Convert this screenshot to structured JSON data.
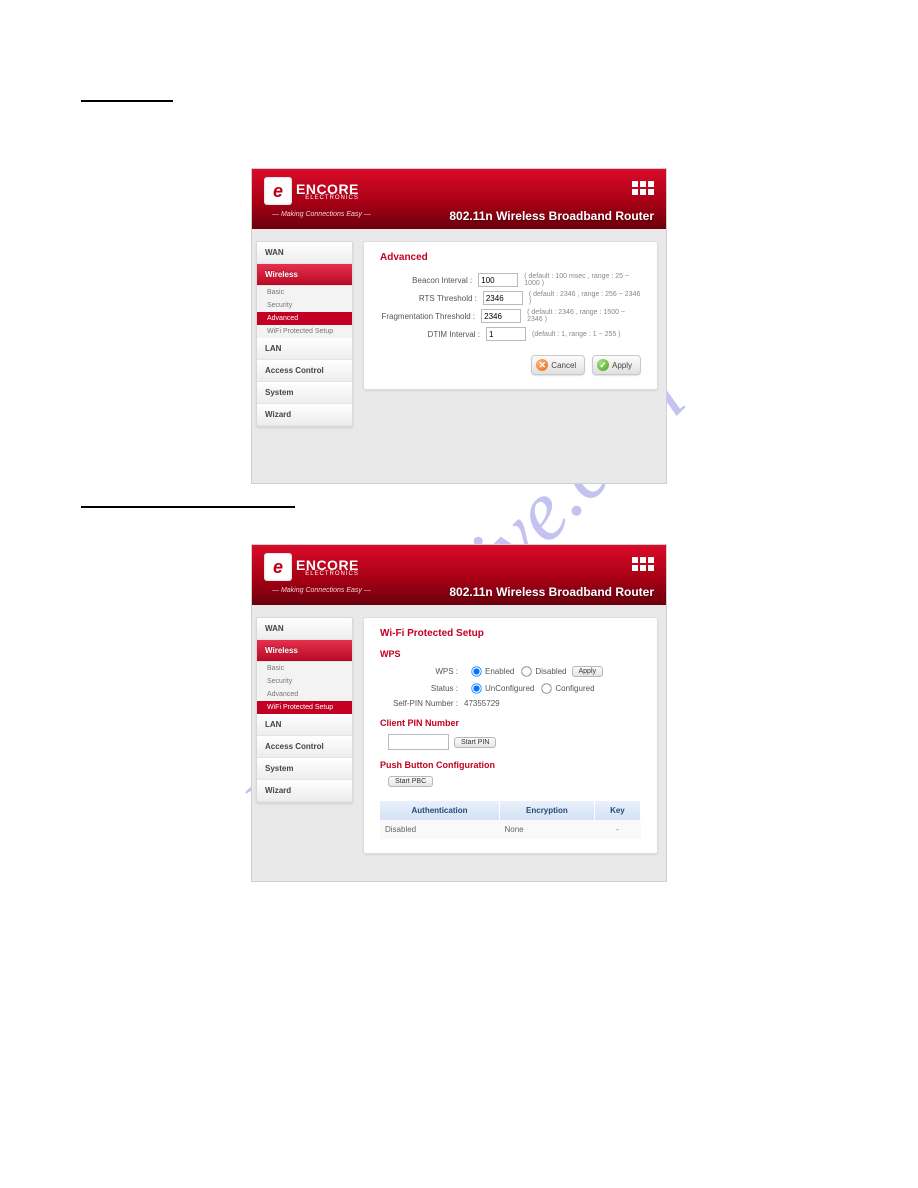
{
  "watermark": "manualshive.com",
  "brand_main": "ENCORE",
  "brand_sub": "ELECTRONICS",
  "brand_mark": "e",
  "tagline": "—   Making Connections Easy   —",
  "header_title": "802.11n Wireless Broadband Router",
  "sidebar": {
    "items": [
      "WAN",
      "Wireless",
      "LAN",
      "Access Control",
      "System",
      "Wizard"
    ],
    "wireless_subs": [
      "Basic",
      "Security",
      "Advanced",
      "WiFi Protected Setup"
    ]
  },
  "advanced": {
    "title": "Advanced",
    "rows": [
      {
        "label": "Beacon Interval :",
        "value": "100",
        "hint": "( default : 100 msec , range : 25 ~ 1000 )"
      },
      {
        "label": "RTS Threshold :",
        "value": "2346",
        "hint": "( default : 2346 , range : 256 ~ 2346 )"
      },
      {
        "label": "Fragmentation Threshold :",
        "value": "2346",
        "hint": "( default : 2346 , range : 1500 ~ 2346 )"
      },
      {
        "label": "DTIM Interval :",
        "value": "1",
        "hint": "(default : 1, range : 1 ~ 255 )"
      }
    ],
    "cancel": "Cancel",
    "apply": "Apply"
  },
  "wps": {
    "title": "Wi-Fi Protected Setup",
    "section_wps": "WPS",
    "wps_label": "WPS :",
    "enabled": "Enabled",
    "disabled": "Disabled",
    "apply": "Apply",
    "status_label": "Status :",
    "status_unconfigured": "UnConfigured",
    "status_configured": "Configured",
    "self_pin_label": "Self-PIN Number :",
    "self_pin_value": "47355729",
    "client_pin_title": "Client PIN Number",
    "start_pin": "Start PIN",
    "pbc_title": "Push Button Configuration",
    "start_pbc": "Start PBC",
    "table": {
      "headers": [
        "Authentication",
        "Encryption",
        "Key"
      ],
      "row": [
        "Disabled",
        "None",
        "-"
      ]
    }
  }
}
